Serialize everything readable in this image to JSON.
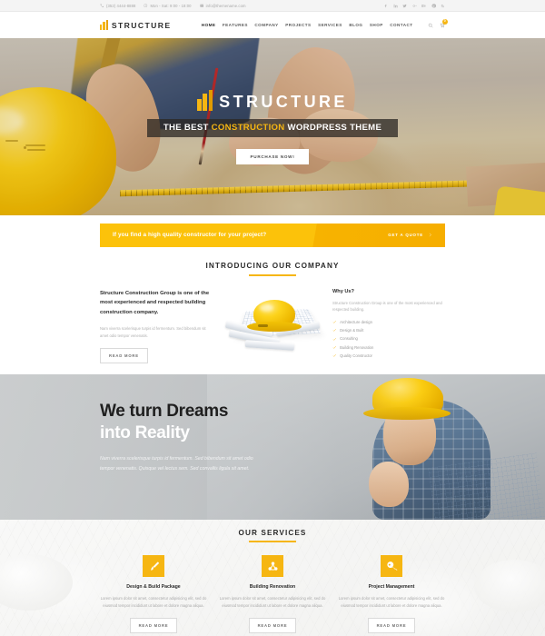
{
  "topbar": {
    "contacts": [
      {
        "icon": "phone-icon",
        "text": "(352) 4444-8888"
      },
      {
        "icon": "clock-icon",
        "text": "Mon - Sat: 9:00 - 18:00"
      },
      {
        "icon": "mail-icon",
        "text": "info@themename.com"
      }
    ],
    "social": [
      "facebook-icon",
      "linkedin-icon",
      "twitter-icon",
      "google-plus-icon",
      "behance-icon",
      "pinterest-icon",
      "rss-icon"
    ]
  },
  "header": {
    "logo_text": "STRUCTURE",
    "nav": [
      {
        "label": "HOME",
        "active": true
      },
      {
        "label": "FEATURES",
        "active": false
      },
      {
        "label": "COMPANY",
        "active": false
      },
      {
        "label": "PROJECTS",
        "active": false
      },
      {
        "label": "SERVICES",
        "active": false
      },
      {
        "label": "BLOG",
        "active": false
      },
      {
        "label": "SHOP",
        "active": false
      },
      {
        "label": "CONTACT",
        "active": false
      }
    ],
    "search_icon": "search-icon",
    "cart_icon": "cart-icon",
    "cart_count": "0"
  },
  "hero": {
    "logo_text": "STRUCTURE",
    "headline_pre": "THE BEST ",
    "headline_accent": "CONSTRUCTION",
    "headline_post": " WORDPRESS THEME",
    "button": "PURCHASE NOW!"
  },
  "cta": {
    "text": "If you find a high quality constructor for your project?",
    "button": "GET A QUOTE"
  },
  "intro": {
    "section_title": "INTRODUCING OUR COMPANY",
    "lead": "Structure Construction Group is one of the most experienced and respected building construction company.",
    "paragraph": "Nam viverra scelerisque turpis id fermentum. Sed bibendum sit amet odio tempor venenatis.",
    "read_more": "READ MORE",
    "why_title": "Why Us?",
    "why_text": "Structure Construction Group is one of the most experienced and respected building.",
    "checks": [
      "Architecture design",
      "Design & Built",
      "Consulting",
      "Building Renovation",
      "Quality Constructor"
    ]
  },
  "dreams": {
    "line1": "We turn Dreams",
    "line2": "into Reality",
    "paragraph": "Nam viverra scelerisque turpis id fermentum. Sed bibendum sit amet odio tempor venenatis. Quisque vel lectus sem. Sed convallis ligula sit amet."
  },
  "services": {
    "section_title": "OUR SERVICES",
    "cards": [
      {
        "icon": "paintbrush-icon",
        "name": "Design & Build Package",
        "desc": "Lorem ipsum dolor sit amet, consectetur adipisicing elit, sed do eiusmod tempor incididunt ut labore et dolore magna aliqua.",
        "button": "READ MORE"
      },
      {
        "icon": "molecule-icon",
        "name": "Building Renovation",
        "desc": "Lorem ipsum dolor sit amet, consectetur adipisicing elit, sed do eiusmod tempor incididunt ut labore et dolore magna aliqua.",
        "button": "READ MORE"
      },
      {
        "icon": "key-icon",
        "name": "Project Management",
        "desc": "Lorem ipsum dolor sit amet, consectetur adipisicing elit, sed do eiusmod tempor incididunt ut labore et dolore magna aliqua.",
        "button": "READ MORE"
      }
    ]
  },
  "colors": {
    "accent": "#f6b612",
    "accent_dark": "#e09c00",
    "dark": "#2b2b2b",
    "muted": "#a9a9a9"
  }
}
